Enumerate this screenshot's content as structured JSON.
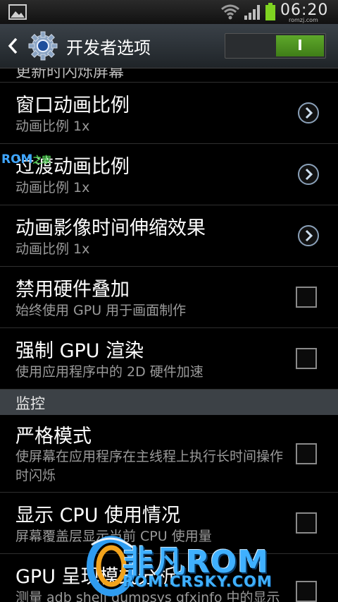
{
  "status_bar": {
    "time": "06:20",
    "watermark": "romzj.com",
    "icons": [
      "picture-icon",
      "wifi-icon",
      "signal-icon",
      "battery-icon"
    ]
  },
  "action_bar": {
    "back_icon": "chevron-left-icon",
    "app_icon": "gear-icon",
    "title": "开发者选项",
    "toggle_label": "I",
    "toggle_on": true
  },
  "list": {
    "partial_row_text": "更新时闪烁屏幕",
    "rows": [
      {
        "title": "窗口动画比例",
        "summary": "动画比例 1x",
        "control": "chevron"
      },
      {
        "title": "过渡动画比例",
        "summary": "动画比例 1x",
        "control": "chevron"
      },
      {
        "title": "动画影像时间伸缩效果",
        "summary": "动画比例 1x",
        "control": "chevron"
      },
      {
        "title": "禁用硬件叠加",
        "summary": "始终使用 GPU 用于画面制作",
        "control": "checkbox",
        "checked": false
      },
      {
        "title": "强制 GPU 渲染",
        "summary": "使用应用程序中的 2D 硬件加速",
        "control": "checkbox",
        "checked": false
      }
    ],
    "section_header": "监控",
    "monitor_rows": [
      {
        "title": "严格模式",
        "summary": "使屏幕在应用程序在主线程上执行长时间操作时闪烁",
        "control": "checkbox",
        "checked": false
      },
      {
        "title": "显示 CPU 使用情况",
        "summary": "屏幕覆盖层显示当前 CPU 使用量",
        "control": "checkbox",
        "checked": false
      },
      {
        "title": "GPU 呈现模式分析",
        "summary": "测量 adb shell dumpsys gfxinfo 中的显示",
        "control": "checkbox",
        "checked": false
      }
    ]
  },
  "watermarks": {
    "rom_badge": "ROM",
    "rom_badge_zh": "之家",
    "brand": "非凡ROM",
    "brand_url": "ROM.CRSKY.COM"
  },
  "colors": {
    "accent_green": "#4a9a20",
    "brand_blue": "#3fb0ff",
    "section_bg": "#3c4146"
  }
}
